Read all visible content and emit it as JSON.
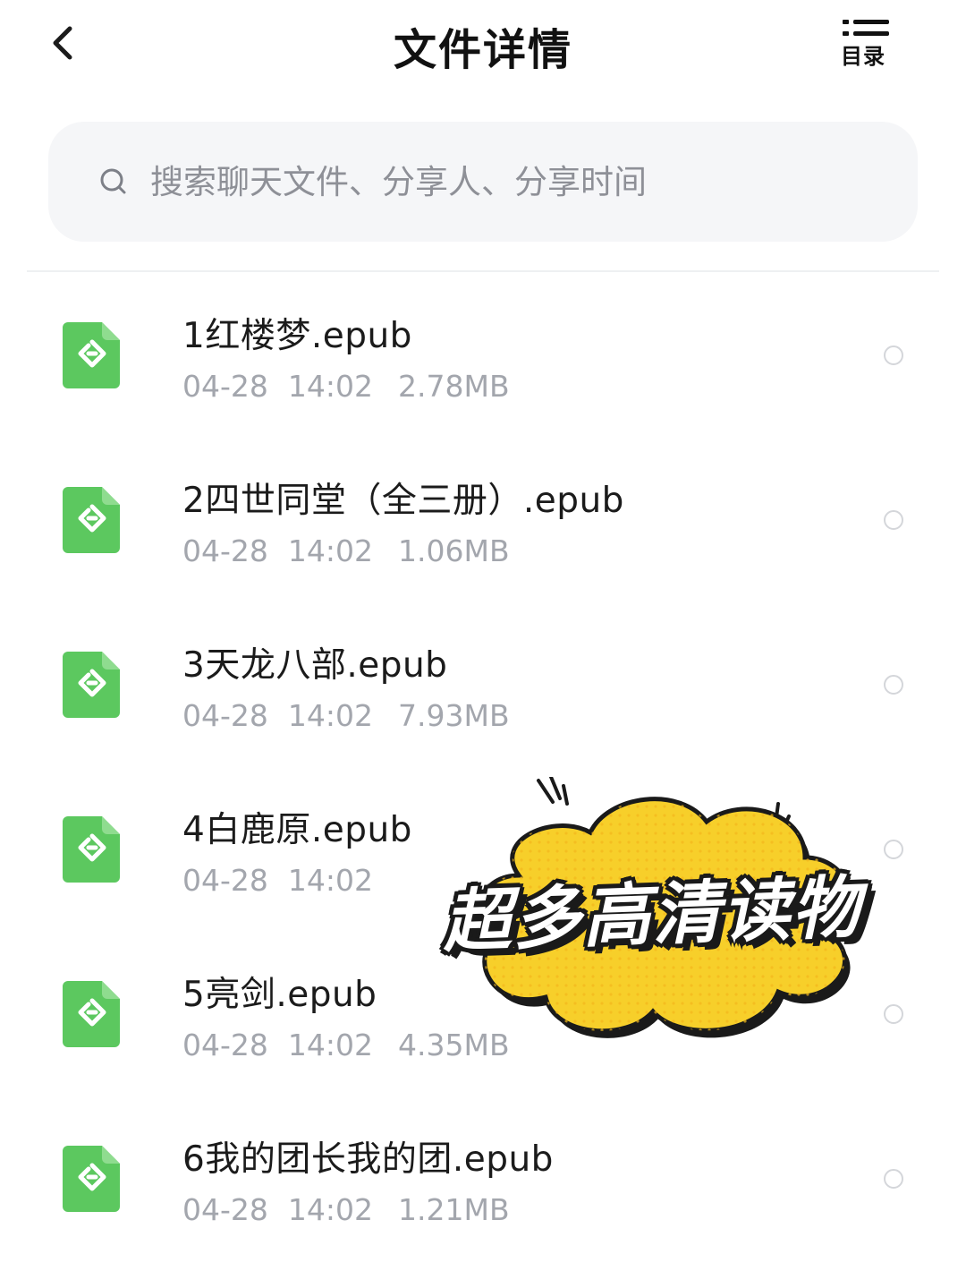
{
  "header": {
    "title": "文件详情",
    "toc_label": "目录"
  },
  "search": {
    "placeholder": "搜索聊天文件、分享人、分享时间",
    "value": ""
  },
  "files": [
    {
      "name": "1红楼梦.epub",
      "date": "04-28",
      "time": "14:02",
      "size": "2.78MB"
    },
    {
      "name": "2四世同堂（全三册）.epub",
      "date": "04-28",
      "time": "14:02",
      "size": "1.06MB"
    },
    {
      "name": "3天龙八部.epub",
      "date": "04-28",
      "time": "14:02",
      "size": "7.93MB"
    },
    {
      "name": "4白鹿原.epub",
      "date": "04-28",
      "time": "14:02",
      "size": ""
    },
    {
      "name": "5亮剑.epub",
      "date": "04-28",
      "time": "14:02",
      "size": "4.35MB"
    },
    {
      "name": "6我的团长我的团.epub",
      "date": "04-28",
      "time": "14:02",
      "size": "1.21MB"
    }
  ],
  "sticker": {
    "text": "超多高清读物"
  },
  "icons": {
    "back": "chevron-left-icon",
    "toc": "list-icon",
    "search": "search-icon",
    "file": "epub-file-icon",
    "select": "radio-circle-icon"
  },
  "colors": {
    "epub_green": "#5cc85f",
    "sticker_yellow": "#f7cf2a",
    "meta_gray": "#a3a6ad",
    "search_bg": "#f5f6f8"
  }
}
